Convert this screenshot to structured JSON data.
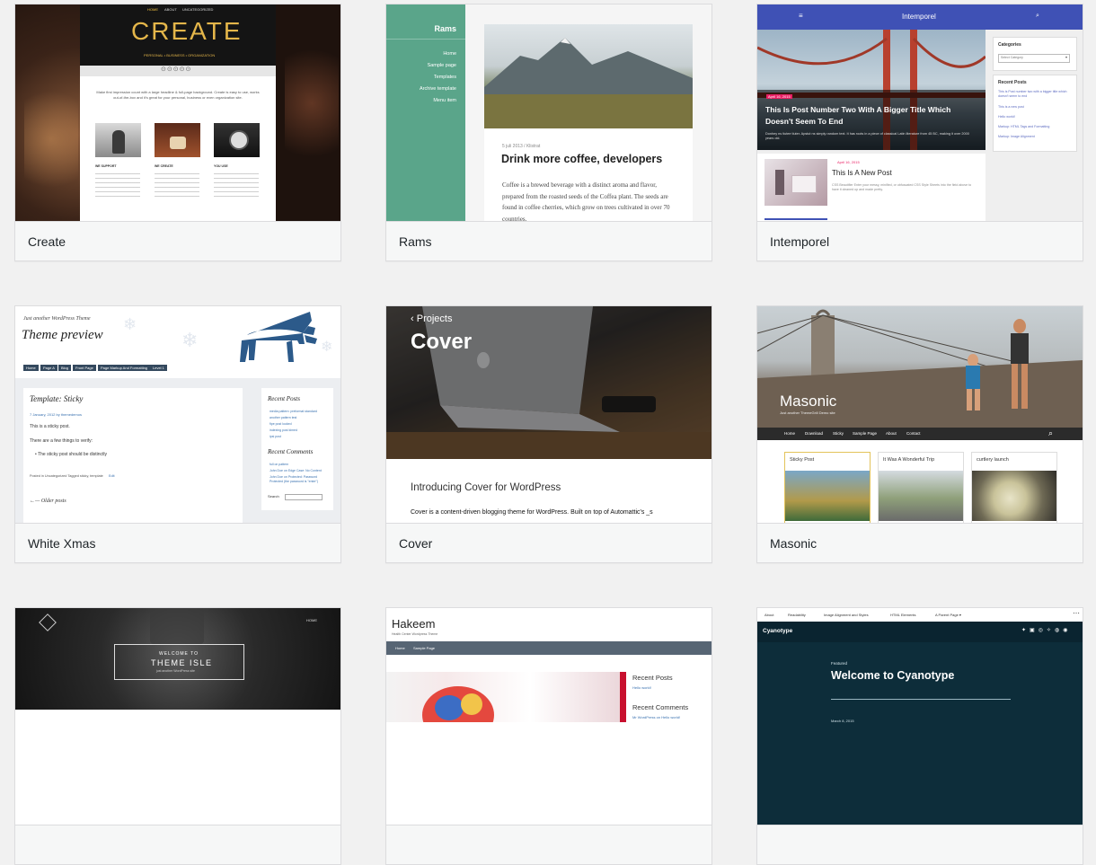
{
  "themes": [
    {
      "name": "Create",
      "preview": {
        "nav": [
          "HOME",
          "ABOUT",
          "UNCATEGORIZED"
        ],
        "title": "CREATE",
        "tagline": "PERSONAL • BUSINESS • ORGANIZATION",
        "intro": "Make first impression count with a large headline & full-page background. Create is easy to use, works out-of-the-box and it's great for your personal, business or even organization site.",
        "features": [
          "WE SUPPORT",
          "WE CREATE",
          "YOU USE"
        ]
      }
    },
    {
      "name": "Rams",
      "preview": {
        "site_title": "Rams",
        "menu": [
          "Home",
          "Sample page",
          "Templates",
          "Archive template",
          "Menu item"
        ],
        "meta": "5 juli 2013 / Klistrat",
        "post_title": "Drink more coffee, developers",
        "excerpt": "Coffee is a brewed beverage with a distinct aroma and flavor, prepared from the roasted seeds of the Coffea plant. The seeds are found in coffee cherries, which grow on trees cultivated in over 70 countries."
      }
    },
    {
      "name": "Intemporel",
      "preview": {
        "site_title": "Intemporel",
        "hero_date": "April 16, 2015",
        "hero_title": "This Is Post Number Two With A Bigger Title Which Doesn't Seem To End",
        "hero_excerpt": "Donhey ns tiutee tiuter. Apstut ns simply random text. It has roots in a piece of classical Latin literature from 45 BC, making it over 2000 years old.",
        "post_date": "April 16, 2015",
        "post_title": "This Is A New Post",
        "post_excerpt": "CSS Beautifier Enter your messy, minified, or obfuscated CSS Style Sheets into the field above to have it cleaned up and made pretty.",
        "categories_label": "Categories",
        "select_placeholder": "Select Category",
        "recent_label": "Recent Posts",
        "recent": [
          "This is Post number two with a bigger title which doesn't seem to end",
          "This is a new post",
          "Hello world!",
          "Markup: HTML Tags and Formatting",
          "Markup: Image Alignment"
        ]
      }
    },
    {
      "name": "White Xmas",
      "preview": {
        "kicker": "Just another WordPress Theme",
        "title": "Theme preview",
        "nav": [
          "Home",
          "Page A",
          "Blog",
          "Front Page",
          "Page Markup And Formatting",
          "Level 1"
        ],
        "post_title": "Template: Sticky",
        "post_meta": "7 January, 2012 by themedemos",
        "body1": "This is a sticky post.",
        "body2": "There are a few things to verify:",
        "bullet": "The sticky post should be distinctly",
        "footer_meta": "Posted in Uncategorized Tagged sticky, template",
        "edit": "Edit",
        "older": "Older posts",
        "recent_posts_title": "Recent Posts",
        "recent_posts": [
          "media pattern: preformat standard",
          "another pattern test",
          "fipe post looked",
          "indexing post kimed",
          "ipsi post"
        ],
        "recent_comments_title": "Recent Comments",
        "recent_comments": [
          "full on pattern",
          "John Doe on Edge Case: No Content",
          "John Doe on Protected: Password Protected (the password is \"enter\")"
        ],
        "search_label": "Search"
      }
    },
    {
      "name": "Cover",
      "preview": {
        "back": "Projects",
        "title": "Cover",
        "heading": "Introducing Cover for WordPress",
        "body": "Cover is a content-driven blogging theme for WordPress. Built on top of Automattic's _s"
      }
    },
    {
      "name": "Masonic",
      "preview": {
        "title": "Masonic",
        "subtitle": "Just another ThemeGrill Demo site",
        "nav": [
          "Home",
          "Download",
          "Sticky",
          "Sample Page",
          "About",
          "Contact"
        ],
        "cards": [
          "Sticky Post",
          "It Was A Wonderful Trip",
          "curtlery launch"
        ]
      }
    },
    {
      "name": "",
      "preview": {
        "nav": "HOME",
        "welcome": "WELCOME TO",
        "title": "THEME ISLE",
        "sub": "just another WordPress site"
      }
    },
    {
      "name": "",
      "preview": {
        "site_title": "Hakeem",
        "tagline": "Health Center Wordpress Theme",
        "nav": [
          "Home",
          "Sample Page"
        ],
        "recent_posts": "Recent Posts",
        "recent_post_item": "Hello world!",
        "recent_comments": "Recent Comments",
        "recent_comment_item": "Mr WordPress on Hello world!"
      }
    },
    {
      "name": "",
      "preview": {
        "menu": [
          "About",
          "Readability",
          "Image Alignment and Styles",
          "HTML Elements",
          "A Parent Page"
        ],
        "site_title": "Cyanotype",
        "featured": "Featured",
        "post_title": "Welcome to Cyanotype",
        "date": "March 8, 2015"
      }
    }
  ]
}
